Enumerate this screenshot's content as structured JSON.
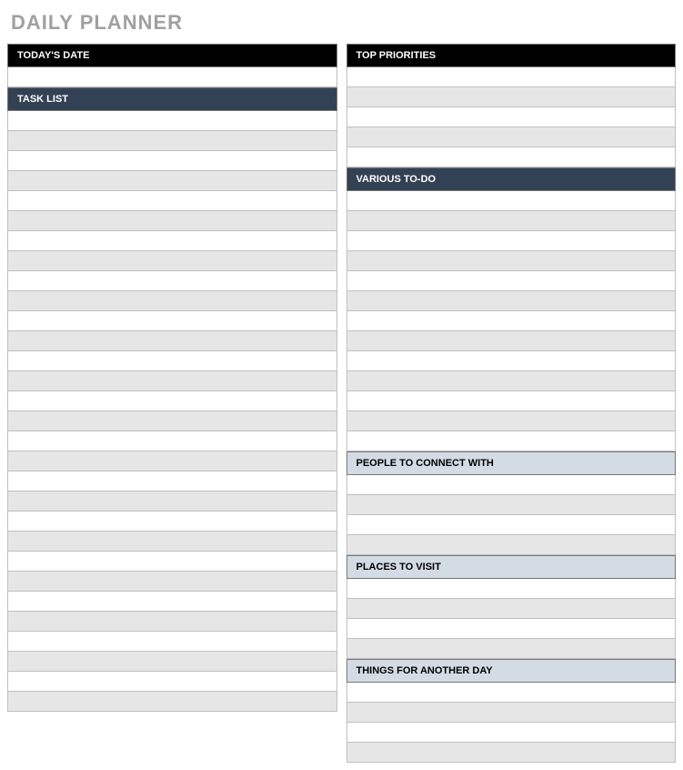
{
  "title": "DAILY PLANNER",
  "left": {
    "todays_date_header": "TODAY'S DATE",
    "todays_date_value": "",
    "task_list_header": "TASK LIST",
    "task_list": [
      "",
      "",
      "",
      "",
      "",
      "",
      "",
      "",
      "",
      "",
      "",
      "",
      "",
      "",
      "",
      "",
      "",
      "",
      "",
      "",
      "",
      "",
      "",
      "",
      "",
      "",
      "",
      "",
      "",
      ""
    ]
  },
  "right": {
    "top_priorities_header": "TOP PRIORITIES",
    "top_priorities": [
      "",
      "",
      "",
      "",
      ""
    ],
    "various_todo_header": "VARIOUS TO-DO",
    "various_todo": [
      "",
      "",
      "",
      "",
      "",
      "",
      "",
      "",
      "",
      "",
      "",
      "",
      ""
    ],
    "people_header": "PEOPLE TO CONNECT WITH",
    "people": [
      "",
      "",
      "",
      ""
    ],
    "places_header": "PLACES TO VISIT",
    "places": [
      "",
      "",
      "",
      ""
    ],
    "things_header": "THINGS FOR ANOTHER DAY",
    "things": [
      "",
      "",
      "",
      ""
    ]
  }
}
